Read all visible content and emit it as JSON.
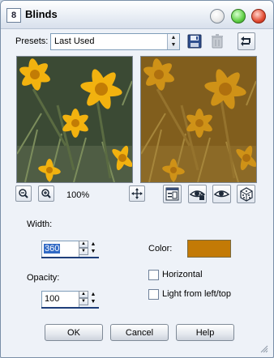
{
  "window": {
    "icon_text": "8",
    "title": "Blinds"
  },
  "presets": {
    "label": "Presets:",
    "value": "Last Used"
  },
  "zoom": {
    "value": "100%"
  },
  "width": {
    "label": "Width:",
    "value": "360"
  },
  "opacity": {
    "label": "Opacity:",
    "value": "100"
  },
  "color": {
    "label": "Color:",
    "value": "#c37a06"
  },
  "options": {
    "horizontal": "Horizontal",
    "light_from": "Light from left/top"
  },
  "buttons": {
    "ok": "OK",
    "cancel": "Cancel",
    "help": "Help"
  }
}
